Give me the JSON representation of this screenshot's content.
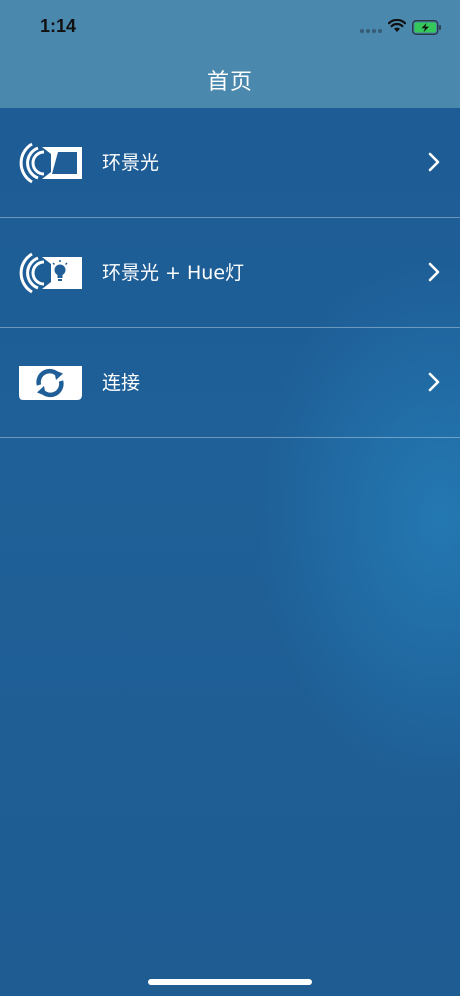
{
  "status_bar": {
    "time": "1:14"
  },
  "nav": {
    "title": "首页"
  },
  "menu": {
    "items": [
      {
        "label": "环景光",
        "icon": "ambient-light-icon"
      },
      {
        "label": "环景光 + Hue灯",
        "icon": "ambient-hue-bulb-icon"
      },
      {
        "label": "连接",
        "icon": "connect-sync-icon"
      }
    ]
  },
  "colors": {
    "header": "#4a88ad",
    "background": "#1f5e96",
    "battery_fill": "#34c759",
    "text": "#ffffff"
  }
}
